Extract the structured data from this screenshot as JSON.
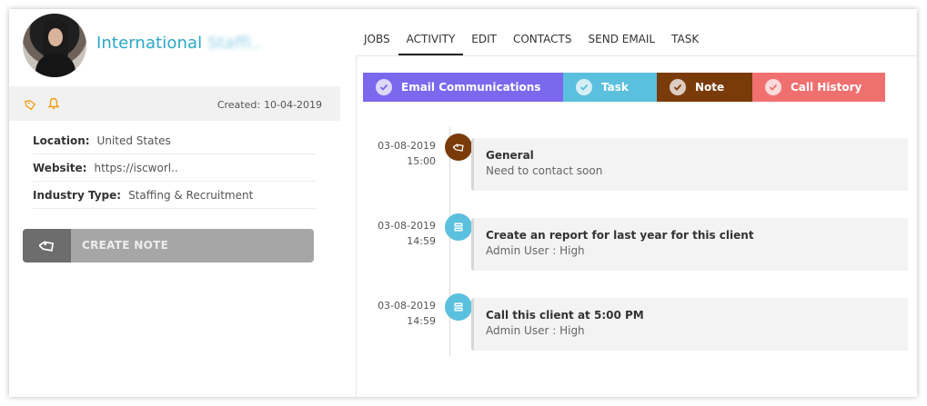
{
  "company": {
    "name_visible": "International",
    "name_blurred": "Staffi.."
  },
  "meta": {
    "created_label": "Created:",
    "created_date": "10-04-2019"
  },
  "info": [
    {
      "label": "Location:",
      "value": "United States"
    },
    {
      "label": "Website:",
      "value": "https://iscworl.."
    },
    {
      "label": "Industry Type:",
      "value": "Staffing & Recruitment"
    }
  ],
  "create_note_label": "CREATE NOTE",
  "tabs": [
    {
      "label": "JOBS"
    },
    {
      "label": "ACTIVITY"
    },
    {
      "label": "EDIT"
    },
    {
      "label": "CONTACTS"
    },
    {
      "label": "SEND EMAIL"
    },
    {
      "label": "TASK"
    }
  ],
  "active_tab": "ACTIVITY",
  "filters": [
    {
      "label": "Email Communications",
      "color": "#7b68ee"
    },
    {
      "label": "Task",
      "color": "#5bc0de"
    },
    {
      "label": "Note",
      "color": "#7a3b0a"
    },
    {
      "label": "Call History",
      "color": "#f07070"
    }
  ],
  "timeline": [
    {
      "date": "03-08-2019",
      "time": "15:00",
      "icon": "tag-icon",
      "dot_color": "#7a3b0a",
      "title": "General",
      "subtitle": "Need to contact soon"
    },
    {
      "date": "03-08-2019",
      "time": "14:59",
      "icon": "task-icon",
      "dot_color": "#5bc0de",
      "title": "Create an report for last year for this client",
      "subtitle": "Admin User : High"
    },
    {
      "date": "03-08-2019",
      "time": "14:59",
      "icon": "task-icon",
      "dot_color": "#5bc0de",
      "title": "Call this client at 5:00 PM",
      "subtitle": "Admin User : High"
    }
  ],
  "colors": {
    "accent": "#2aa7c6",
    "tag_icon": "#f39c12",
    "bell_icon": "#f39c12"
  }
}
